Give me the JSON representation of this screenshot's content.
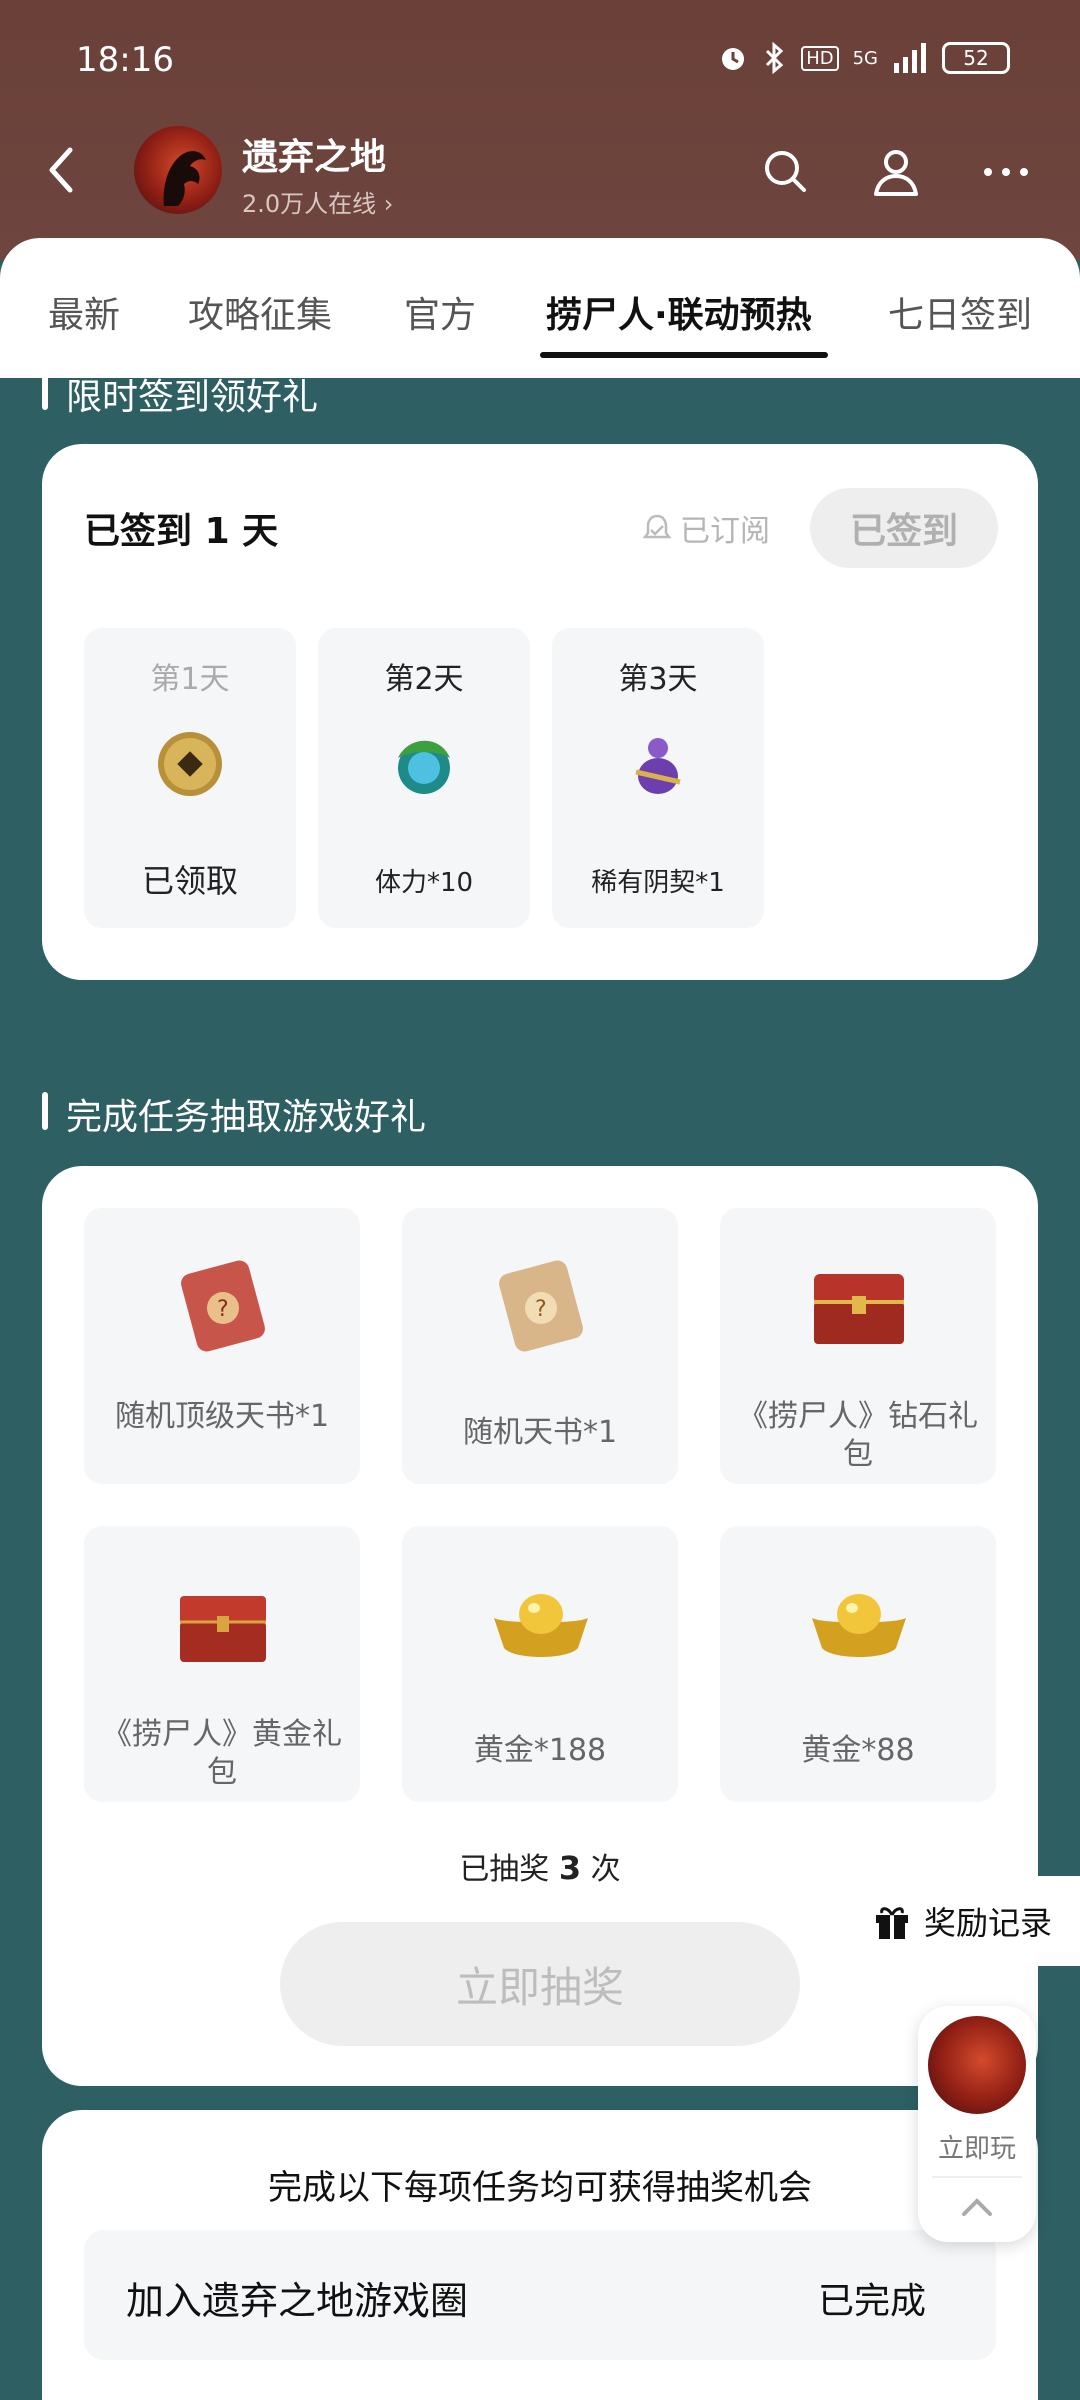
{
  "status_bar": {
    "time": "18:16",
    "battery": "52",
    "network": "5G",
    "hd": "HD"
  },
  "header": {
    "game_name": "遗弃之地",
    "online": "2.0万人在线",
    "icons": [
      "back-icon",
      "search-icon",
      "user-icon",
      "more-icon"
    ]
  },
  "tabs": [
    {
      "label": "最新"
    },
    {
      "label": "攻略征集"
    },
    {
      "label": "官方"
    },
    {
      "label": "捞尸人·联动预热",
      "active": true
    },
    {
      "label": "七日签到"
    }
  ],
  "signin": {
    "section_title": "限时签到领好礼",
    "signed_days_prefix": "已签到",
    "signed_days": "1",
    "signed_days_suffix": "天",
    "subscribed": "已订阅",
    "signed_button": "已签到",
    "days": [
      {
        "label": "第1天",
        "reward": "已领取",
        "icon": "copper-coin-icon",
        "claimed": true
      },
      {
        "label": "第2天",
        "reward": "体力*10",
        "icon": "stamina-orb-icon",
        "claimed": false
      },
      {
        "label": "第3天",
        "reward": "稀有阴契*1",
        "icon": "purple-gourd-icon",
        "claimed": false
      }
    ]
  },
  "lottery": {
    "section_title": "完成任务抽取游戏好礼",
    "prizes": [
      {
        "name": "随机顶级天书*1",
        "icon": "red-scroll-icon"
      },
      {
        "name": "随机天书*1",
        "icon": "tan-scroll-icon"
      },
      {
        "name": "《捞尸人》钻石礼包",
        "icon": "ornate-chest-icon"
      },
      {
        "name": "《捞尸人》黄金礼包",
        "icon": "red-chest-icon"
      },
      {
        "name": "黄金*188",
        "icon": "gold-ingot-icon"
      },
      {
        "name": "黄金*88",
        "icon": "gold-ingot-icon"
      }
    ],
    "drawn_prefix": "已抽奖",
    "drawn_count": "3",
    "drawn_suffix": "次",
    "draw_button": "立即抽奖",
    "reward_record": "奖励记录"
  },
  "tasks": {
    "title": "完成以下每项任务均可获得抽奖机会",
    "items": [
      {
        "name": "加入遗弃之地游戏圈",
        "status": "已完成"
      }
    ]
  },
  "float_play": {
    "label": "立即玩"
  },
  "colors": {
    "header_bg": "#6a4038",
    "page_bg": "#2e5f63",
    "card_bg": "#ffffff",
    "tile_bg": "#f4f6f8"
  }
}
